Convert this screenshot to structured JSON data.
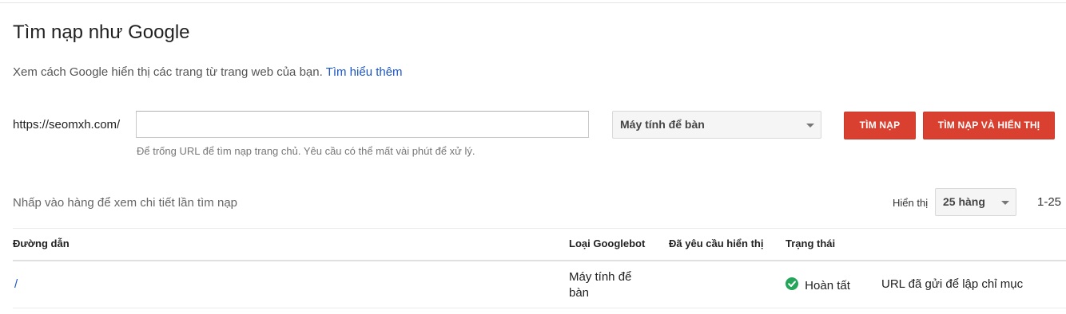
{
  "page": {
    "title": "Tìm nạp như Google",
    "description": "Xem cách Google hiển thị các trang từ trang web của bạn.",
    "learn_more": "Tìm hiểu thêm"
  },
  "fetch_form": {
    "url_prefix": "https://seomxh.com/",
    "url_value": "",
    "url_hint": "Để trống URL để tìm nạp trang chủ. Yêu cầu có thể mất vài phút để xử lý.",
    "device_selected": "Máy tính để bàn",
    "fetch_button": "TÌM NẠP",
    "fetch_render_button": "TÌM NẠP VÀ HIỂN THỊ"
  },
  "table": {
    "note": "Nhấp vào hàng để xem chi tiết lần tìm nạp",
    "show_label": "Hiển thị",
    "rows_per_page": "25 hàng",
    "range": "1-25",
    "columns": {
      "path": "Đường dẫn",
      "googlebot_type": "Loại Googlebot",
      "render_requested": "Đã yêu cầu hiển thị",
      "status": "Trạng thái"
    },
    "rows": [
      {
        "path": "/",
        "googlebot_type": "Máy tính để bàn",
        "render_requested": "",
        "status": "Hoàn tất",
        "status_icon": "check-circle-icon",
        "index_action": "URL đã gửi để lập chỉ mục"
      }
    ]
  },
  "colors": {
    "primary_button": "#d9402f",
    "link": "#1a55c9",
    "success": "#23a55a"
  }
}
